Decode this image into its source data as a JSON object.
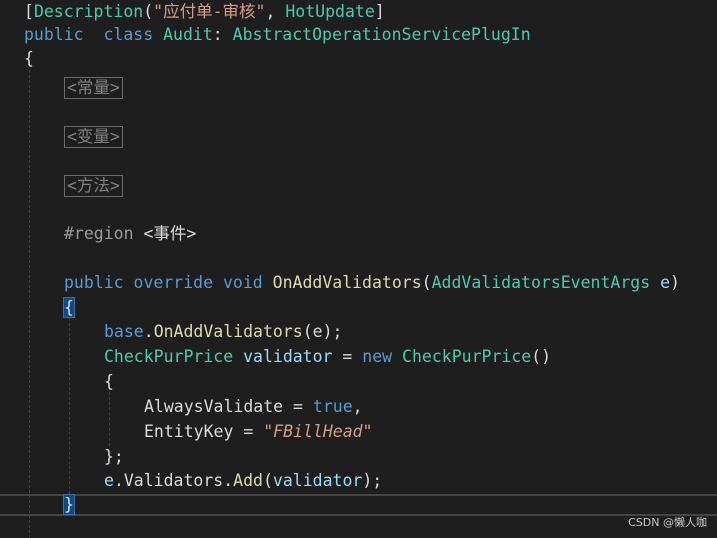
{
  "code": {
    "attribute_line": {
      "open_bracket": "[",
      "attr_name": "Description",
      "open_paren": "(",
      "attr_string": "\"应付单-审核\"",
      "comma": ",",
      "hot_update": "HotUpdate",
      "close_bracket": "]"
    },
    "class_line": {
      "kw_public": "public",
      "kw_class": "class",
      "class_name": "Audit",
      "colon": ":",
      "base_class": "AbstractOperationServicePlugIn"
    },
    "open_brace": "{",
    "collapsed_regions": [
      "<常量>",
      "<变量>",
      "<方法>"
    ],
    "region_line": {
      "directive": "#region",
      "name": "<事件>"
    },
    "method_signature": {
      "kw_public": "public",
      "kw_override": "override",
      "kw_void": "void",
      "method_name": "OnAddValidators",
      "open_paren": "(",
      "param_type": "AddValidatorsEventArgs",
      "param_name": "e",
      "close_paren": ")"
    },
    "method_open_brace": "{",
    "base_call": {
      "kw_base": "base",
      "dot": ".",
      "method": "OnAddValidators",
      "args": "(e);"
    },
    "declaration": {
      "type": "CheckPurPrice",
      "var": "validator",
      "eq": "=",
      "kw_new": "new",
      "ctor": "CheckPurPrice",
      "parens": "()"
    },
    "init_open": "{",
    "init_line1": {
      "prop": "AlwaysValidate",
      "eq": "=",
      "val": "true",
      "comma": ","
    },
    "init_line2": {
      "prop": "EntityKey",
      "eq": "=",
      "val": "\"FBillHead\""
    },
    "init_close": "};",
    "add_line": {
      "obj": "e",
      "dot1": ".",
      "prop": "Validators",
      "dot2": ".",
      "method": "Add",
      "open": "(",
      "arg": "validator",
      "close": ");"
    },
    "method_close_brace": "}"
  },
  "watermark": "CSDN @懒人咖"
}
